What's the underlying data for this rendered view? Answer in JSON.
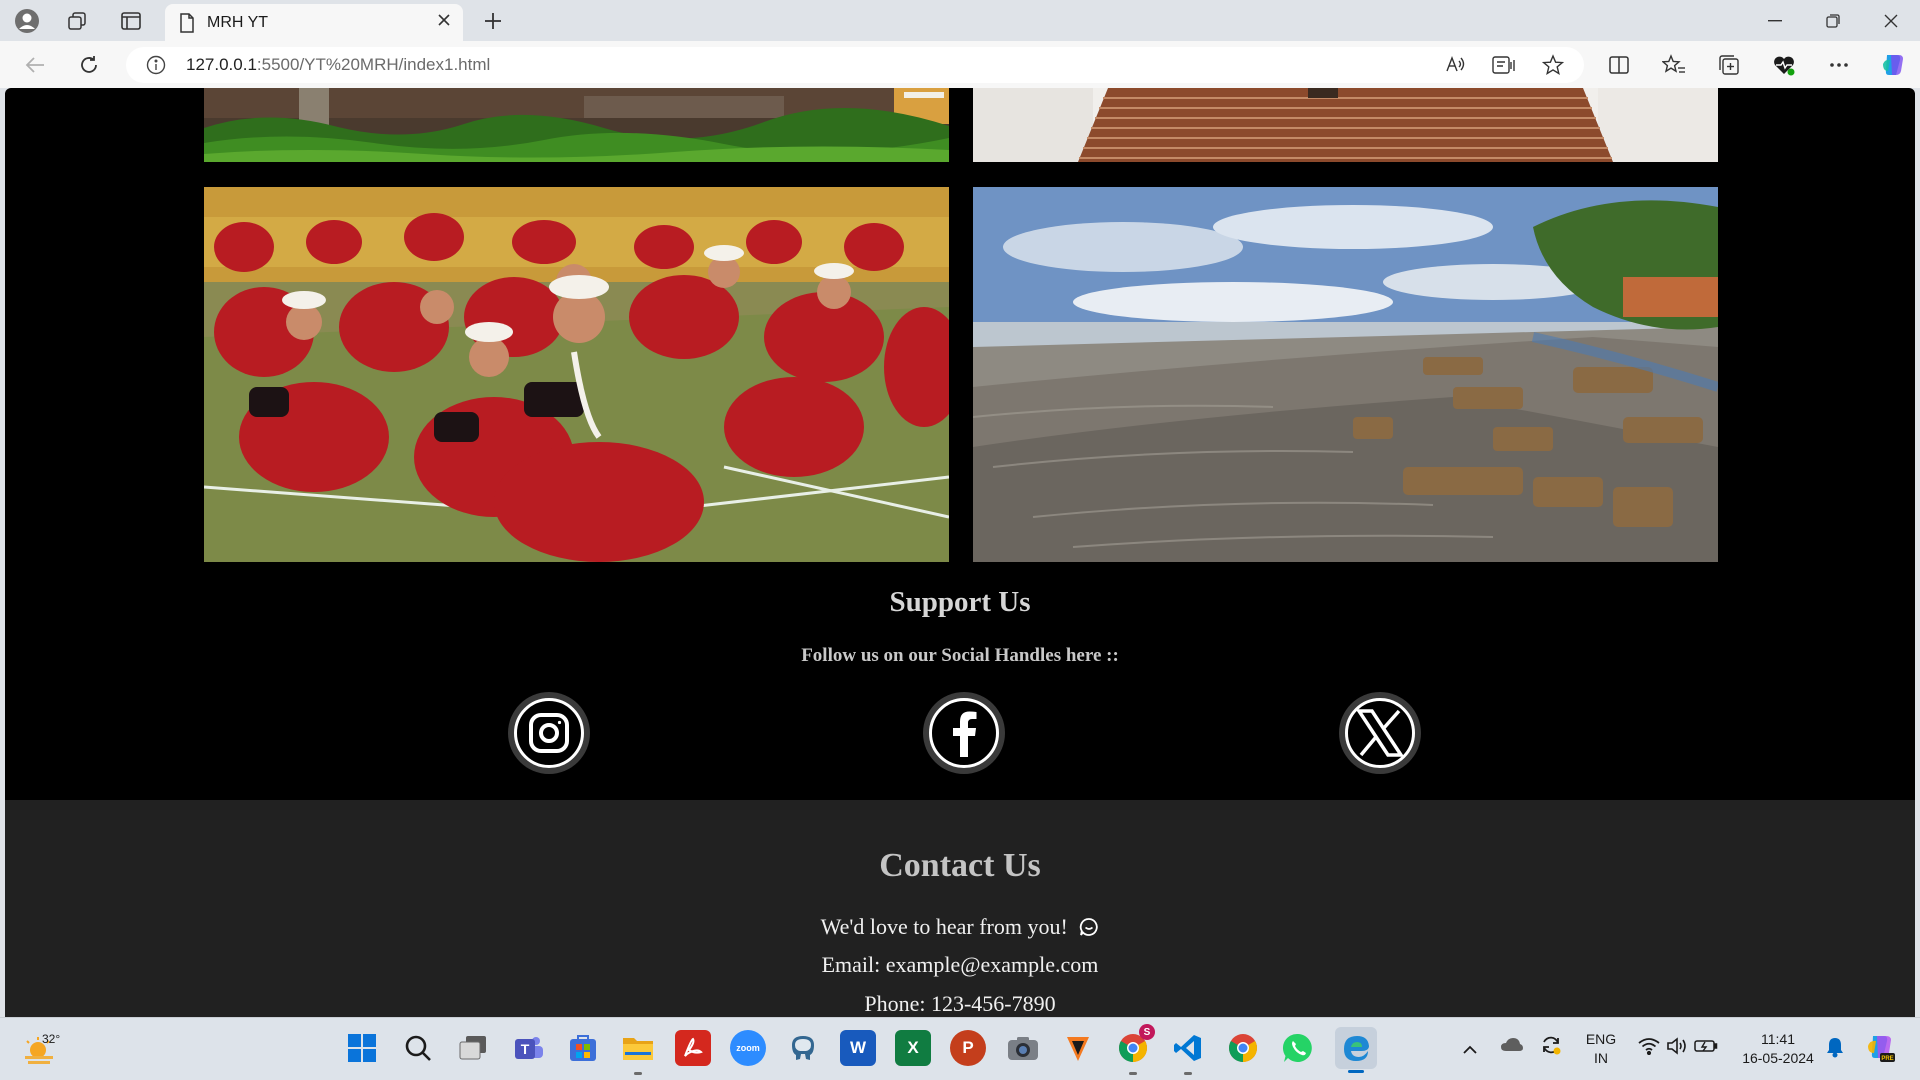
{
  "browser": {
    "tab_title": "MRH YT",
    "url_host": "127.0.0.1",
    "url_rest": ":5500/YT%20MRH/index1.html",
    "icons": [
      "profile-icon",
      "workspaces-icon",
      "tab-actions-icon",
      "page-icon",
      "close-icon",
      "new-tab-icon",
      "minimize-icon",
      "restore-icon",
      "window-close-icon",
      "back-icon",
      "refresh-icon",
      "info-icon",
      "read-aloud-icon",
      "immersive-reader-icon",
      "favorite-star-icon",
      "split-screen-icon",
      "favorites-icon",
      "collections-icon",
      "browser-essentials-icon",
      "more-icon",
      "copilot-icon"
    ]
  },
  "page": {
    "support": {
      "title": "Support Us",
      "subtitle": "Follow us on our Social Handles here ::",
      "socials": [
        "instagram-icon",
        "facebook-icon",
        "x-twitter-icon"
      ]
    },
    "contact": {
      "title": "Contact Us",
      "line1": "We'd love to hear from you!",
      "email": "Email: example@example.com",
      "phone": "Phone: 123-456-7890"
    }
  },
  "taskbar": {
    "weather_temp": "32°",
    "language_top": "ENG",
    "language_bottom": "IN",
    "time": "11:41",
    "date": "16-05-2024",
    "apps": [
      "windows-start-icon",
      "search-icon",
      "task-view-icon",
      "teams-icon",
      "store-icon",
      "file-explorer-icon",
      "acrobat-icon",
      "zoom-icon",
      "pgadmin-icon",
      "word-icon",
      "excel-icon",
      "powerpoint-icon",
      "camera-icon",
      "vlc-icon",
      "chrome-profile-icon",
      "vscode-icon",
      "chrome-icon",
      "whatsapp-icon",
      "edge-icon"
    ],
    "zoom_label": "zoom",
    "chrome_badge": "S",
    "colors": {
      "word": "#185abd",
      "excel": "#107c41",
      "powerpoint": "#c43e1c",
      "acrobat": "#d4281e",
      "zoom": "#2d8cff",
      "whatsapp": "#25d366",
      "vscode": "#0078d4"
    }
  }
}
